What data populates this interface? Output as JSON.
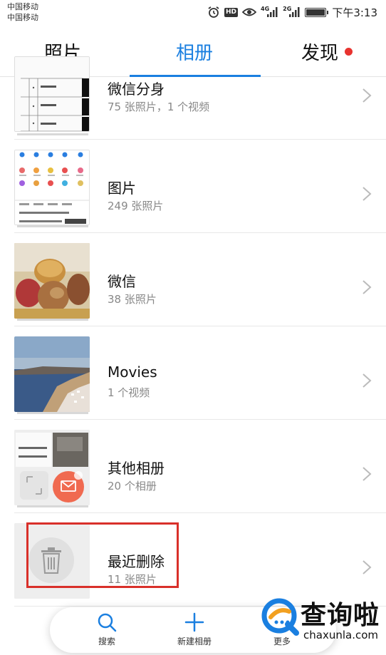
{
  "status_bar": {
    "carrier_1": "中国移动",
    "carrier_2": "中国移动",
    "network_4g": "4G",
    "network_2g": "2G",
    "hd_badge": "HD",
    "time": "下午3:13",
    "battery_level": 1.0,
    "icons": [
      "alarm-icon",
      "hd-icon",
      "eye-icon",
      "signal-icon",
      "signal-icon",
      "battery-icon"
    ]
  },
  "tabs": [
    {
      "label": "照片",
      "active": false
    },
    {
      "label": "相册",
      "active": true
    },
    {
      "label": "发现",
      "active": false,
      "has_dot": true
    }
  ],
  "albums": [
    {
      "title": "微信分身",
      "subtitle": "75 张照片，1 个视频"
    },
    {
      "title": "图片",
      "subtitle": "249 张照片"
    },
    {
      "title": "微信",
      "subtitle": "38 张照片"
    },
    {
      "title": "Movies",
      "subtitle": "1 个视频"
    },
    {
      "title": "其他相册",
      "subtitle": "20 个相册"
    },
    {
      "title": "最近删除",
      "subtitle": "11 张照片",
      "highlighted": true
    }
  ],
  "bottom_nav": [
    {
      "label": "搜索",
      "icon": "search-icon"
    },
    {
      "label": "新建相册",
      "icon": "plus-icon"
    },
    {
      "label": "更多",
      "icon": "more-icon"
    }
  ],
  "watermark": {
    "text": "查询啦",
    "url": "chaxunla.com"
  },
  "colors": {
    "accent": "#1a7fe0",
    "notification_dot": "#e8332f",
    "highlight_box": "#d9302a",
    "subtitle": "#888888"
  }
}
